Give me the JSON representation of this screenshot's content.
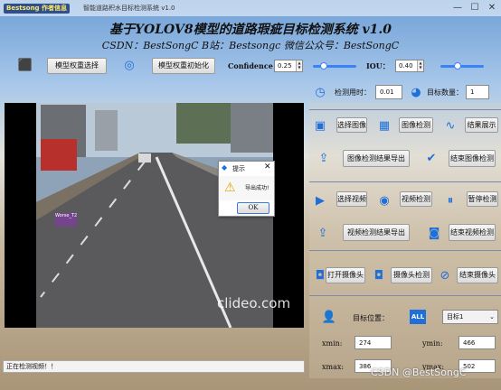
{
  "titlebar": {
    "logo": "Bestsong 作者信息",
    "title": "智能道路积水目标检测系统 v1.0"
  },
  "header": {
    "title": "基于YOLOV8模型的道路瑕疵目标检测系统 v1.0",
    "subtitle": "CSDN：BestSongC   B站：Bestsongc   微信公众号：BestSongC"
  },
  "toolbar": {
    "select_weights": "模型权重选择",
    "init_weights": "模型权重初始化",
    "confidence_label": "Confidence",
    "confidence_value": "0.25",
    "iou_label": "IOU：",
    "iou_value": "0.40",
    "confidence_level": 0.25,
    "iou_level": 0.4
  },
  "stats": {
    "time_label": "检测用时：",
    "time_value": "0.01",
    "count_label": "目标数量：",
    "count_value": "1"
  },
  "image_section": {
    "select": "选择图像",
    "detect": "图像检测",
    "show": "结果展示",
    "export": "图像检测结果导出",
    "finish": "结束图像检测"
  },
  "video_section": {
    "select": "选择视频",
    "detect": "视频检测",
    "pause": "暂停检测",
    "export": "视频检测结果导出",
    "finish": "结束视频检测"
  },
  "camera_section": {
    "open": "打开摄像头",
    "detect": "摄像头检测",
    "finish": "结束摄像头"
  },
  "target": {
    "label": "目标位置：",
    "all_badge": "ALL",
    "selected": "目标1",
    "xmin_label": "xmin:",
    "xmin": "274",
    "ymin_label": "ymin:",
    "ymin": "466",
    "xmax_label": "xmax:",
    "xmax": "386",
    "ymax_label": "ymax:",
    "ymax": "502"
  },
  "video": {
    "watermark": "clideo.com",
    "detection_label": "Worse_T2"
  },
  "dialog": {
    "title": "提示",
    "message": "导出成功!",
    "ok": "OK",
    "close": "✕"
  },
  "status": {
    "text": "正在检测视频！！"
  },
  "footer_watermark": "CSDN @BestSongC",
  "colors": {
    "accent": "#1e6fd9",
    "slider": "#3b82f6"
  }
}
